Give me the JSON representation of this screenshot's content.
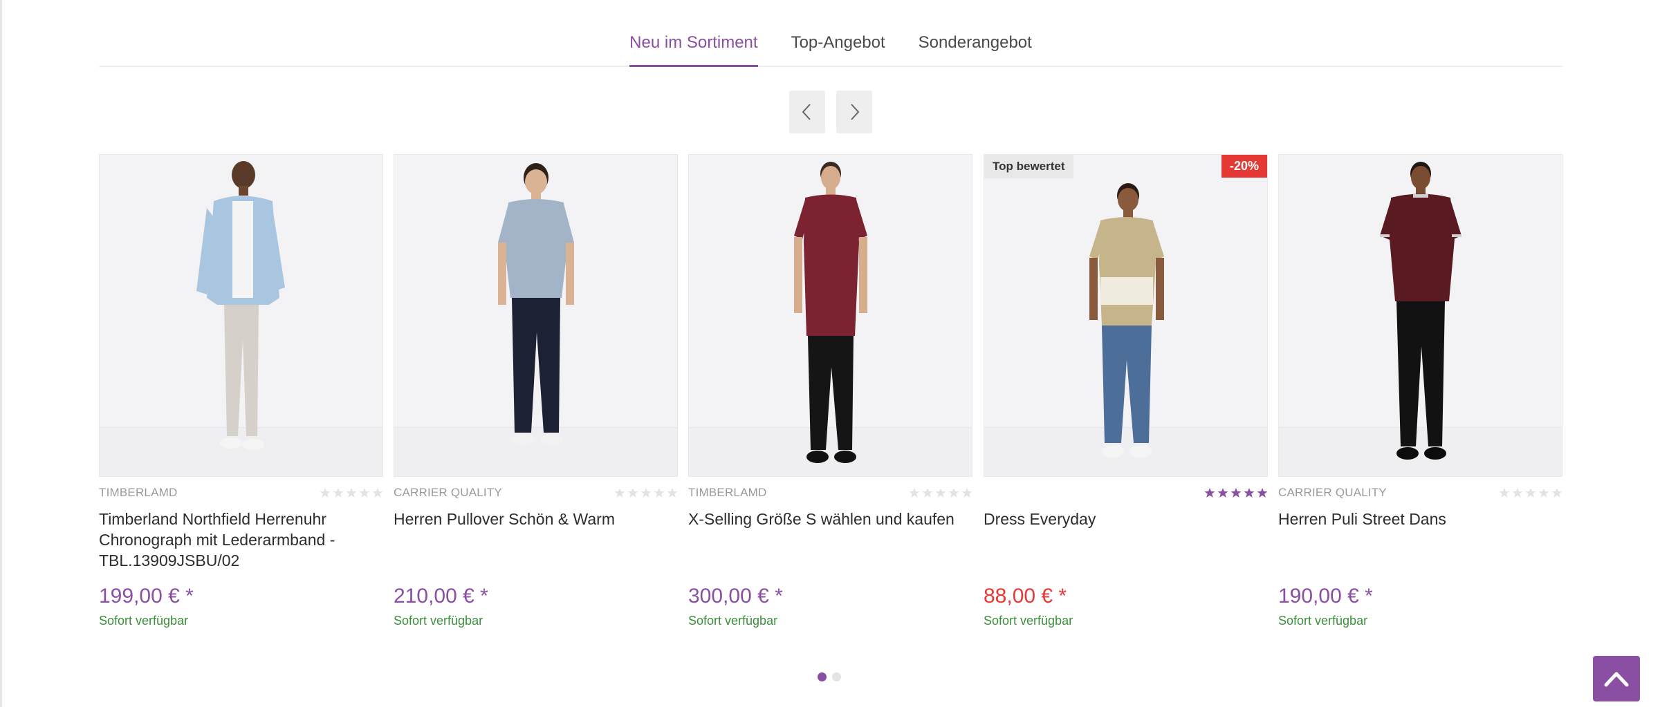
{
  "tabs": [
    {
      "label": "Neu im Sortiment",
      "active": true
    },
    {
      "label": "Top-Angebot",
      "active": false
    },
    {
      "label": "Sonderangebot",
      "active": false
    }
  ],
  "colors": {
    "accent": "#8a4fa3",
    "sale": "#e53935",
    "available": "#3a8f3a"
  },
  "products": [
    {
      "brand": "TIMBERLAMD",
      "title": "Timberland Northfield Herrenuhr Chronograph mit Lederarmband - TBL.13909JSBU/02",
      "price": "199,00 € *",
      "availability": "Sofort verfügbar",
      "rating": 0,
      "badge": "",
      "discount": "",
      "image_icon": "denim-jacket-model-image"
    },
    {
      "brand": "CARRIER QUALITY",
      "title": "Herren Pullover Schön & Warm",
      "price": "210,00 € *",
      "availability": "Sofort verfügbar",
      "rating": 0,
      "badge": "",
      "discount": "",
      "image_icon": "polo-shirt-model-image"
    },
    {
      "brand": "TIMBERLAMD",
      "title": "X-Selling Größe S wählen und kaufen",
      "price": "300,00 € *",
      "availability": "Sofort verfügbar",
      "rating": 0,
      "badge": "",
      "discount": "",
      "image_icon": "burgundy-tshirt-model-image"
    },
    {
      "brand": "",
      "title": "Dress Everyday",
      "price": "88,00 € *",
      "availability": "Sofort verfügbar",
      "rating": 5,
      "badge": "Top bewertet",
      "discount": "-20%",
      "image_icon": "tie-dye-tshirt-model-image"
    },
    {
      "brand": "CARRIER QUALITY",
      "title": "Herren Puli Street Dans",
      "price": "190,00 € *",
      "availability": "Sofort verfügbar",
      "rating": 0,
      "badge": "",
      "discount": "",
      "image_icon": "maroon-tshirt-model-image"
    }
  ],
  "pagination": {
    "pages": 2,
    "current": 1
  }
}
